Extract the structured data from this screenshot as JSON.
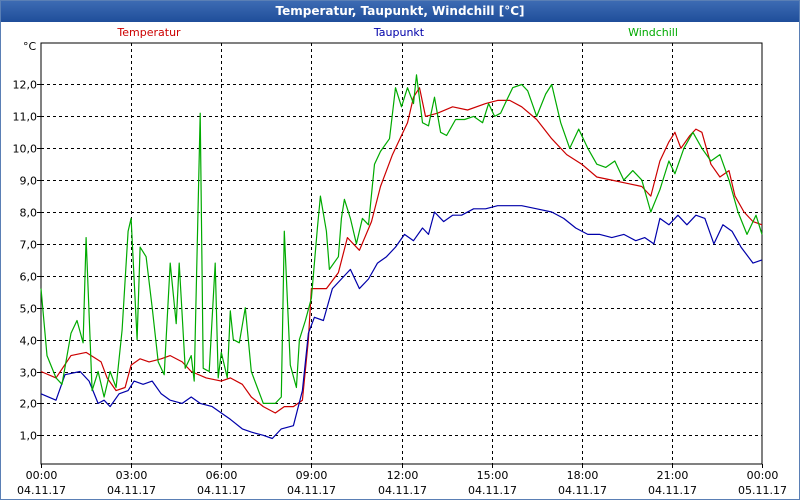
{
  "window": {
    "title": "Temperatur, Taupunkt, Windchill [°C]"
  },
  "chart_data": {
    "type": "line",
    "title": "Temperatur, Taupunkt, Windchill [°C]",
    "ylabel": "°C",
    "xlabel": "",
    "ylim": [
      0.1,
      13.3
    ],
    "xlim": [
      0,
      24
    ],
    "grid": true,
    "legend_position": "top",
    "yticks": [
      1,
      2,
      3,
      4,
      5,
      6,
      7,
      8,
      9,
      10,
      11,
      12
    ],
    "ytick_labels": [
      "1,0",
      "2,0",
      "3,0",
      "4,0",
      "5,0",
      "6,0",
      "7,0",
      "8,0",
      "9,0",
      "10,0",
      "11,0",
      "12,0"
    ],
    "xticks": [
      {
        "x": 0,
        "time": "00:00",
        "date": "04.11.17"
      },
      {
        "x": 3,
        "time": "03:00",
        "date": "04.11.17"
      },
      {
        "x": 6,
        "time": "06:00",
        "date": "04.11.17"
      },
      {
        "x": 9,
        "time": "09:00",
        "date": "04.11.17"
      },
      {
        "x": 12,
        "time": "12:00",
        "date": "04.11.17"
      },
      {
        "x": 15,
        "time": "15:00",
        "date": "04.11.17"
      },
      {
        "x": 18,
        "time": "18:00",
        "date": "04.11.17"
      },
      {
        "x": 21,
        "time": "21:00",
        "date": "04.11.17"
      },
      {
        "x": 24,
        "time": "00:00",
        "date": "05.11.17"
      }
    ],
    "series": [
      {
        "name": "Temperatur",
        "color": "#cc0000",
        "points": [
          [
            0,
            3.0
          ],
          [
            0.5,
            2.8
          ],
          [
            1.0,
            3.5
          ],
          [
            1.5,
            3.6
          ],
          [
            2.0,
            3.3
          ],
          [
            2.2,
            2.8
          ],
          [
            2.5,
            2.4
          ],
          [
            2.8,
            2.5
          ],
          [
            3.0,
            3.2
          ],
          [
            3.3,
            3.4
          ],
          [
            3.6,
            3.3
          ],
          [
            4.0,
            3.4
          ],
          [
            4.3,
            3.5
          ],
          [
            4.7,
            3.3
          ],
          [
            5.0,
            3.0
          ],
          [
            5.5,
            2.8
          ],
          [
            6.0,
            2.7
          ],
          [
            6.3,
            2.8
          ],
          [
            6.7,
            2.6
          ],
          [
            7.0,
            2.2
          ],
          [
            7.4,
            1.9
          ],
          [
            7.8,
            1.7
          ],
          [
            8.1,
            1.9
          ],
          [
            8.4,
            1.9
          ],
          [
            8.7,
            2.1
          ],
          [
            8.9,
            4.0
          ],
          [
            9.0,
            5.6
          ],
          [
            9.5,
            5.6
          ],
          [
            9.9,
            6.1
          ],
          [
            10.2,
            7.2
          ],
          [
            10.6,
            6.8
          ],
          [
            11.0,
            7.7
          ],
          [
            11.3,
            8.8
          ],
          [
            11.7,
            9.8
          ],
          [
            12.0,
            10.4
          ],
          [
            12.2,
            10.8
          ],
          [
            12.4,
            11.6
          ],
          [
            12.6,
            11.9
          ],
          [
            12.8,
            11.0
          ],
          [
            13.2,
            11.1
          ],
          [
            13.7,
            11.3
          ],
          [
            14.2,
            11.2
          ],
          [
            14.8,
            11.4
          ],
          [
            15.2,
            11.5
          ],
          [
            15.6,
            11.5
          ],
          [
            16.0,
            11.3
          ],
          [
            16.5,
            10.9
          ],
          [
            17.0,
            10.3
          ],
          [
            17.5,
            9.8
          ],
          [
            18.0,
            9.5
          ],
          [
            18.5,
            9.1
          ],
          [
            19.0,
            9.0
          ],
          [
            19.5,
            8.9
          ],
          [
            20.0,
            8.8
          ],
          [
            20.3,
            8.5
          ],
          [
            20.6,
            9.6
          ],
          [
            20.9,
            10.2
          ],
          [
            21.1,
            10.5
          ],
          [
            21.3,
            10.0
          ],
          [
            21.6,
            10.4
          ],
          [
            21.8,
            10.6
          ],
          [
            22.0,
            10.5
          ],
          [
            22.3,
            9.5
          ],
          [
            22.6,
            9.1
          ],
          [
            22.9,
            9.3
          ],
          [
            23.1,
            8.5
          ],
          [
            23.4,
            8.0
          ],
          [
            23.7,
            7.7
          ],
          [
            24.0,
            7.6
          ]
        ]
      },
      {
        "name": "Taupunkt",
        "color": "#0000aa",
        "points": [
          [
            0,
            2.3
          ],
          [
            0.5,
            2.1
          ],
          [
            0.8,
            2.9
          ],
          [
            1.3,
            3.0
          ],
          [
            1.6,
            2.7
          ],
          [
            1.9,
            2.0
          ],
          [
            2.1,
            2.1
          ],
          [
            2.3,
            1.9
          ],
          [
            2.6,
            2.3
          ],
          [
            2.9,
            2.4
          ],
          [
            3.1,
            2.7
          ],
          [
            3.4,
            2.6
          ],
          [
            3.7,
            2.7
          ],
          [
            4.0,
            2.3
          ],
          [
            4.3,
            2.1
          ],
          [
            4.7,
            2.0
          ],
          [
            5.0,
            2.2
          ],
          [
            5.3,
            2.0
          ],
          [
            5.7,
            1.9
          ],
          [
            6.0,
            1.7
          ],
          [
            6.3,
            1.5
          ],
          [
            6.7,
            1.2
          ],
          [
            7.0,
            1.1
          ],
          [
            7.4,
            1.0
          ],
          [
            7.7,
            0.9
          ],
          [
            8.0,
            1.2
          ],
          [
            8.4,
            1.3
          ],
          [
            8.7,
            2.4
          ],
          [
            8.9,
            4.2
          ],
          [
            9.1,
            4.7
          ],
          [
            9.4,
            4.6
          ],
          [
            9.7,
            5.6
          ],
          [
            10.0,
            5.9
          ],
          [
            10.3,
            6.2
          ],
          [
            10.6,
            5.6
          ],
          [
            10.9,
            5.9
          ],
          [
            11.2,
            6.4
          ],
          [
            11.5,
            6.6
          ],
          [
            11.8,
            6.9
          ],
          [
            12.1,
            7.3
          ],
          [
            12.4,
            7.1
          ],
          [
            12.7,
            7.5
          ],
          [
            12.9,
            7.3
          ],
          [
            13.1,
            8.0
          ],
          [
            13.4,
            7.7
          ],
          [
            13.7,
            7.9
          ],
          [
            14.0,
            7.9
          ],
          [
            14.4,
            8.1
          ],
          [
            14.8,
            8.1
          ],
          [
            15.2,
            8.2
          ],
          [
            15.6,
            8.2
          ],
          [
            16.0,
            8.2
          ],
          [
            16.5,
            8.1
          ],
          [
            17.0,
            8.0
          ],
          [
            17.4,
            7.8
          ],
          [
            17.8,
            7.5
          ],
          [
            18.2,
            7.3
          ],
          [
            18.6,
            7.3
          ],
          [
            19.0,
            7.2
          ],
          [
            19.4,
            7.3
          ],
          [
            19.8,
            7.1
          ],
          [
            20.1,
            7.2
          ],
          [
            20.4,
            7.0
          ],
          [
            20.6,
            7.8
          ],
          [
            20.9,
            7.6
          ],
          [
            21.2,
            7.9
          ],
          [
            21.5,
            7.6
          ],
          [
            21.8,
            7.9
          ],
          [
            22.1,
            7.8
          ],
          [
            22.4,
            7.0
          ],
          [
            22.7,
            7.6
          ],
          [
            23.0,
            7.4
          ],
          [
            23.3,
            6.9
          ],
          [
            23.7,
            6.4
          ],
          [
            24.0,
            6.5
          ]
        ]
      },
      {
        "name": "Windchill",
        "color": "#00aa00",
        "points": [
          [
            0,
            5.6
          ],
          [
            0.2,
            3.5
          ],
          [
            0.5,
            2.8
          ],
          [
            0.7,
            2.6
          ],
          [
            1.0,
            4.2
          ],
          [
            1.2,
            4.6
          ],
          [
            1.4,
            3.9
          ],
          [
            1.5,
            7.2
          ],
          [
            1.7,
            2.4
          ],
          [
            1.9,
            3.0
          ],
          [
            2.1,
            2.2
          ],
          [
            2.3,
            3.0
          ],
          [
            2.5,
            2.5
          ],
          [
            2.7,
            4.3
          ],
          [
            2.9,
            7.4
          ],
          [
            3.0,
            7.8
          ],
          [
            3.2,
            4.0
          ],
          [
            3.3,
            6.9
          ],
          [
            3.5,
            6.6
          ],
          [
            3.7,
            5.0
          ],
          [
            3.9,
            3.3
          ],
          [
            4.1,
            2.9
          ],
          [
            4.3,
            6.4
          ],
          [
            4.5,
            4.5
          ],
          [
            4.6,
            6.4
          ],
          [
            4.8,
            3.1
          ],
          [
            5.0,
            3.5
          ],
          [
            5.1,
            2.7
          ],
          [
            5.3,
            11.1
          ],
          [
            5.4,
            3.1
          ],
          [
            5.6,
            3.0
          ],
          [
            5.8,
            6.4
          ],
          [
            5.9,
            2.8
          ],
          [
            6.0,
            3.6
          ],
          [
            6.2,
            2.8
          ],
          [
            6.3,
            4.9
          ],
          [
            6.4,
            4.0
          ],
          [
            6.6,
            3.9
          ],
          [
            6.8,
            5.0
          ],
          [
            7.0,
            3.0
          ],
          [
            7.2,
            2.5
          ],
          [
            7.4,
            2.0
          ],
          [
            7.6,
            2.0
          ],
          [
            7.8,
            2.0
          ],
          [
            8.0,
            2.2
          ],
          [
            8.1,
            7.4
          ],
          [
            8.3,
            3.2
          ],
          [
            8.5,
            2.5
          ],
          [
            8.6,
            4.0
          ],
          [
            8.8,
            4.6
          ],
          [
            9.0,
            5.3
          ],
          [
            9.2,
            7.5
          ],
          [
            9.3,
            8.5
          ],
          [
            9.5,
            7.4
          ],
          [
            9.6,
            6.2
          ],
          [
            9.9,
            6.6
          ],
          [
            10.0,
            7.8
          ],
          [
            10.1,
            8.4
          ],
          [
            10.3,
            7.8
          ],
          [
            10.5,
            7.0
          ],
          [
            10.7,
            7.8
          ],
          [
            10.9,
            7.6
          ],
          [
            11.1,
            9.5
          ],
          [
            11.3,
            9.9
          ],
          [
            11.6,
            10.3
          ],
          [
            11.8,
            11.9
          ],
          [
            12.0,
            11.3
          ],
          [
            12.2,
            11.9
          ],
          [
            12.4,
            11.4
          ],
          [
            12.5,
            12.3
          ],
          [
            12.7,
            10.8
          ],
          [
            12.9,
            10.7
          ],
          [
            13.1,
            11.6
          ],
          [
            13.3,
            10.5
          ],
          [
            13.5,
            10.4
          ],
          [
            13.8,
            10.9
          ],
          [
            14.1,
            10.9
          ],
          [
            14.4,
            11.0
          ],
          [
            14.7,
            10.8
          ],
          [
            14.9,
            11.4
          ],
          [
            15.1,
            11.0
          ],
          [
            15.3,
            11.1
          ],
          [
            15.5,
            11.5
          ],
          [
            15.7,
            11.9
          ],
          [
            16.0,
            12.0
          ],
          [
            16.2,
            11.8
          ],
          [
            16.5,
            11.0
          ],
          [
            16.8,
            11.7
          ],
          [
            17.0,
            12.0
          ],
          [
            17.3,
            10.8
          ],
          [
            17.6,
            10.0
          ],
          [
            17.9,
            10.6
          ],
          [
            18.2,
            10.0
          ],
          [
            18.5,
            9.5
          ],
          [
            18.8,
            9.4
          ],
          [
            19.1,
            9.6
          ],
          [
            19.4,
            9.0
          ],
          [
            19.7,
            9.3
          ],
          [
            20.0,
            9.0
          ],
          [
            20.3,
            8.0
          ],
          [
            20.6,
            8.7
          ],
          [
            20.9,
            9.6
          ],
          [
            21.1,
            9.2
          ],
          [
            21.4,
            10.0
          ],
          [
            21.7,
            10.5
          ],
          [
            22.0,
            10.0
          ],
          [
            22.3,
            9.6
          ],
          [
            22.6,
            9.8
          ],
          [
            22.9,
            9.0
          ],
          [
            23.2,
            8.0
          ],
          [
            23.5,
            7.3
          ],
          [
            23.8,
            7.9
          ],
          [
            24.0,
            7.3
          ]
        ]
      }
    ]
  }
}
